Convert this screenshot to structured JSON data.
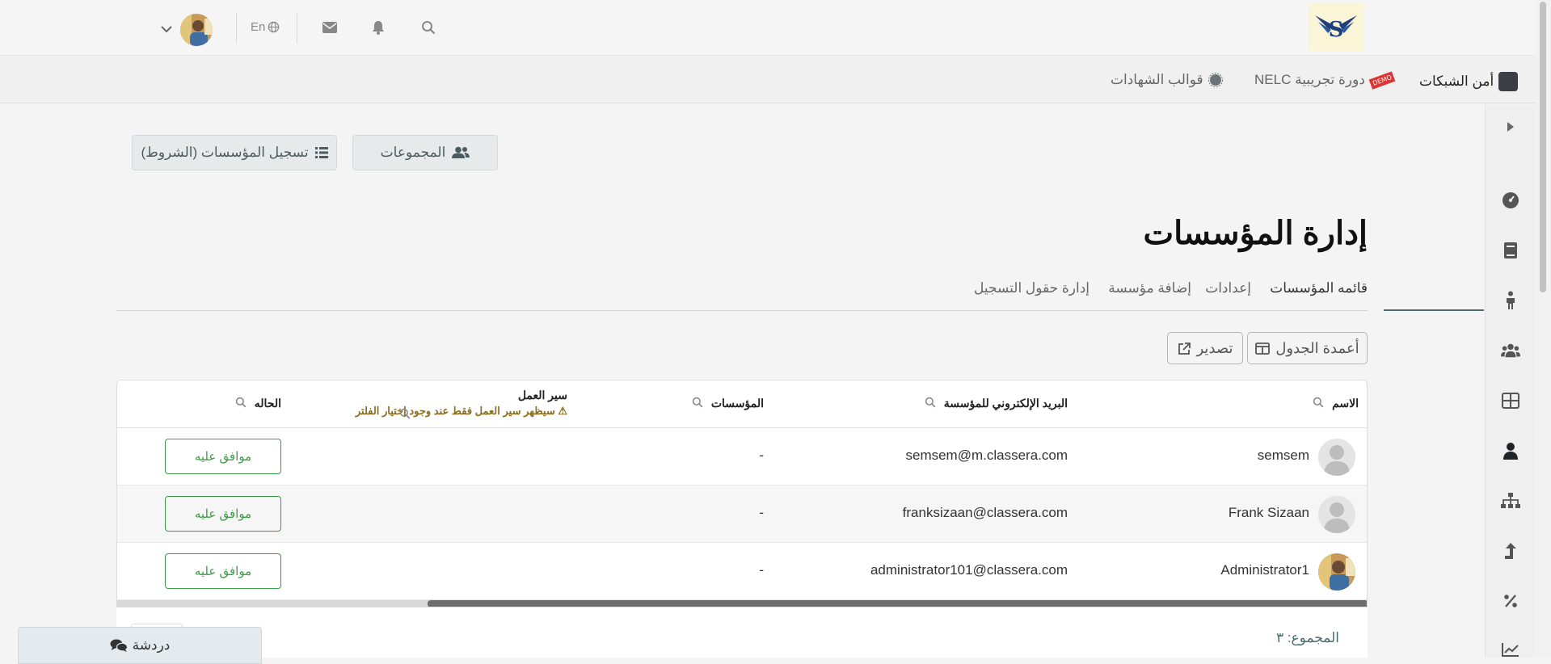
{
  "header": {
    "lang_label": "En",
    "logo_name": "brand-logo"
  },
  "coursebar": {
    "course_title": "أمن الشبكات",
    "demo_badge": "DEMO",
    "demo_course": "دورة تجريبية NELC",
    "certificates": "قوالب الشهادات"
  },
  "actions": {
    "groups": "المجموعات",
    "registration": "تسجيل المؤسسات (الشروط)"
  },
  "page": {
    "title": "إدارة المؤسسات"
  },
  "tabs": [
    {
      "label": "قائمه المؤسسات",
      "active": true
    },
    {
      "label": "إعدادات",
      "active": false
    },
    {
      "label": "إضافة مؤسسة",
      "active": false
    },
    {
      "label": "إدارة حقول التسجيل",
      "active": false
    }
  ],
  "toolbar": {
    "columns": "أعمدة الجدول",
    "export": "تصدير"
  },
  "table": {
    "headers": {
      "name": "الاسم",
      "email": "البريد الإلكتروني للمؤسسة",
      "institutions": "المؤسسات",
      "workflow": "سير العمل",
      "workflow_warning": "سيظهر سير العمل فقط عند وجود إختيار الفلتر",
      "status": "الحاله"
    },
    "rows": [
      {
        "name": "semsem",
        "email": "semsem@m.classera.com",
        "institutions": "-",
        "status": "موافق عليه"
      },
      {
        "name": "Frank Sizaan",
        "email": "franksizaan@classera.com",
        "institutions": "-",
        "status": "موافق عليه"
      },
      {
        "name": "Administrator1",
        "email": "administrator101@classera.com",
        "institutions": "-",
        "status": "موافق عليه"
      }
    ],
    "total": "المجموع: ٣"
  },
  "chat": {
    "label": "دردشة"
  },
  "colors": {
    "accent": "#4a6b70",
    "approve": "#3d9a47",
    "warning": "#8b6d1e"
  }
}
